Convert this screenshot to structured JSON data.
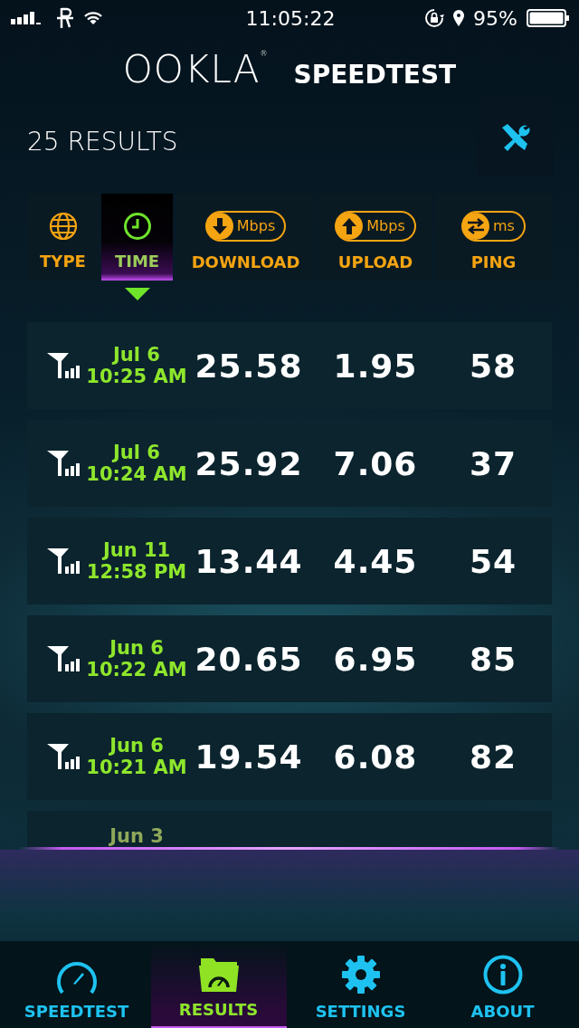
{
  "status_bar": {
    "time": "11:05:22",
    "battery": "95%"
  },
  "header": {
    "logo": "OOKLA",
    "logo_mark": "®",
    "title": "SPEEDTEST"
  },
  "results_count": "25 RESULTS",
  "columns": [
    {
      "kind": "globe",
      "label": "TYPE",
      "selected": false
    },
    {
      "kind": "clock",
      "label": "TIME",
      "selected": true
    },
    {
      "kind": "down",
      "label": "DOWNLOAD",
      "unit": "Mbps",
      "selected": false
    },
    {
      "kind": "up",
      "label": "UPLOAD",
      "unit": "Mbps",
      "selected": false
    },
    {
      "kind": "ping",
      "label": "PING",
      "unit": "ms",
      "selected": false
    }
  ],
  "results": [
    {
      "date": "Jul 6",
      "time": "10:25 AM",
      "download": "25.58",
      "upload": "1.95",
      "ping": "58"
    },
    {
      "date": "Jul 6",
      "time": "10:24 AM",
      "download": "25.92",
      "upload": "7.06",
      "ping": "37"
    },
    {
      "date": "Jun 11",
      "time": "12:58 PM",
      "download": "13.44",
      "upload": "4.45",
      "ping": "54"
    },
    {
      "date": "Jun 6",
      "time": "10:22 AM",
      "download": "20.65",
      "upload": "6.95",
      "ping": "85"
    },
    {
      "date": "Jun 6",
      "time": "10:21 AM",
      "download": "19.54",
      "upload": "6.08",
      "ping": "82"
    }
  ],
  "partial_result": {
    "date": "Jun 3"
  },
  "tab_bar": [
    {
      "kind": "gauge",
      "label": "SPEEDTEST",
      "selected": false
    },
    {
      "kind": "folder",
      "label": "RESULTS",
      "selected": true
    },
    {
      "kind": "gear",
      "label": "SETTINGS",
      "selected": false
    },
    {
      "kind": "info",
      "label": "ABOUT",
      "selected": false
    }
  ]
}
